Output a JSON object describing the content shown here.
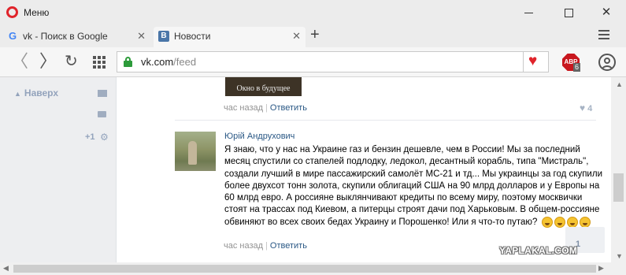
{
  "window": {
    "title": "Меню",
    "minimize_icon": "minimize-icon",
    "maximize_icon": "maximize-icon",
    "close_symbol": "✕"
  },
  "tabs": [
    {
      "favicon": "G",
      "label": "vk - Поиск в Google",
      "close": "✕"
    },
    {
      "favicon": "В",
      "label": "Новости",
      "close": "✕"
    }
  ],
  "new_tab_symbol": "+",
  "toolbar": {
    "back_symbol": "〈",
    "forward_symbol": "〉",
    "reload_symbol": "↻",
    "url_domain": "vk.com",
    "url_path": "/feed",
    "heart_symbol": "♥",
    "adblock_label": "ABP",
    "adblock_count": "6"
  },
  "sidebar": {
    "up_label": "Наверх",
    "up_symbol": "▲",
    "counter": "+1",
    "gear_symbol": "⚙"
  },
  "post": {
    "video_caption": "Окно в будущее",
    "time": "час назад",
    "reply": "Ответить",
    "likes": "4",
    "like_symbol": "♥"
  },
  "comment": {
    "author": "Юрій Андрухович",
    "text": "Я знаю, что у нас на Украине газ и бензин дешевле, чем в России! Мы за последний месяц спустили со стапелей подлодку, ледокол, десантный корабль, типа \"Мистраль\", создали лучший в мире пассажирский самолёт МС-21 и тд... Мы украинцы за год скупили более двухсот тонн золота, скупили облигаций США на 90 млрд долларов и у Европы на 60 млрд евро. А россияне выклянчивают кредиты по всему миру, поэтому москвички стоят на трассах под Киевом, а питерцы строят дачи под Харьковым. В общем-россияне обвиняют во всех своих бедах Украину и Порошенко! Или я что-то путаю?",
    "emoji_count": 4,
    "time": "час назад",
    "reply": "Ответить",
    "chat_count": "1"
  },
  "separator": "|",
  "watermark": "YAPLAKAL.COM",
  "scroll": {
    "up": "▲",
    "down": "▼",
    "left": "◀",
    "right": "▶"
  }
}
